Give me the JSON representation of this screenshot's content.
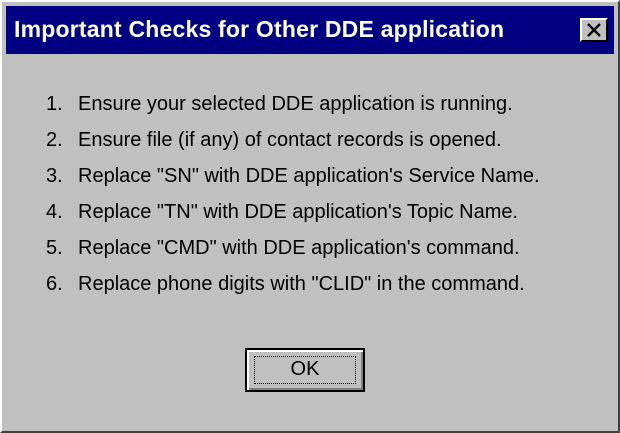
{
  "window": {
    "title": "Important Checks for Other DDE application",
    "close_icon": "close-x-icon"
  },
  "checks": [
    {
      "num": "1.",
      "text": "Ensure your selected DDE application  is running."
    },
    {
      "num": "2.",
      "text": "Ensure file (if any)  of contact records is opened."
    },
    {
      "num": "3.",
      "text": "Replace \"SN\" with DDE application's Service Name."
    },
    {
      "num": "4.",
      "text": "Replace \"TN\" with DDE application's Topic Name."
    },
    {
      "num": "5.",
      "text": "Replace \"CMD\" with DDE application's command."
    },
    {
      "num": "6.",
      "text": "Replace phone digits with \"CLID\" in the command."
    }
  ],
  "buttons": {
    "ok_label": "OK"
  },
  "colors": {
    "titlebar": "#000080",
    "face": "#c0c0c0"
  }
}
